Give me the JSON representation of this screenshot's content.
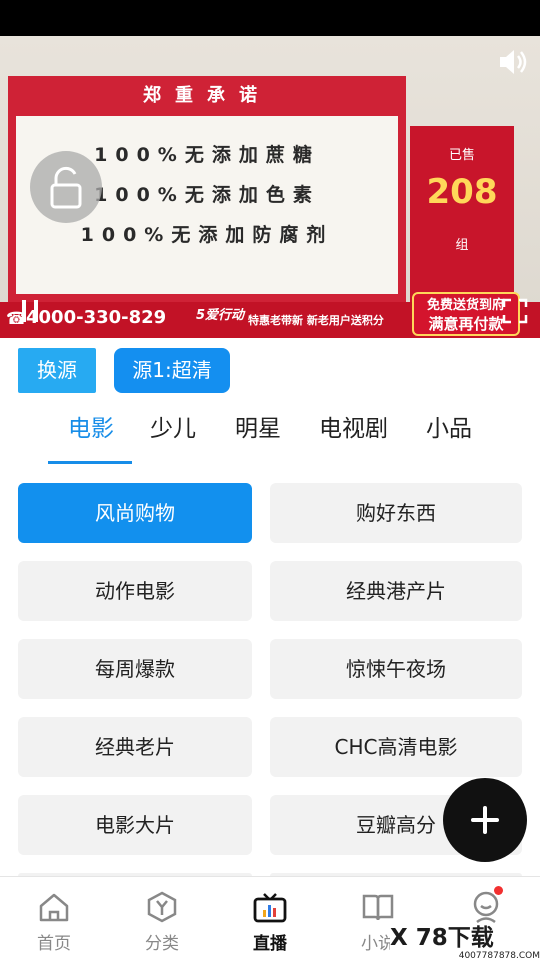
{
  "video": {
    "board_title": "郑重承诺",
    "promises": [
      "100%无添加蔗糖",
      "100%无添加色素",
      "100%无添加防腐剂"
    ],
    "sold_label": "已售",
    "sold_count": "208",
    "sold_unit": "组",
    "ticker_phone": "4000-330-829",
    "ticker_promo": "特惠老带新  新老用户送积分",
    "ticker_tag": "5爱行动",
    "badge_line1": "免费送货到府",
    "badge_line2": "满意再付款"
  },
  "source": {
    "switch_label": "换源",
    "current_label": "源1:超清"
  },
  "tabs": [
    {
      "label": "电影",
      "active": true
    },
    {
      "label": "少儿",
      "active": false
    },
    {
      "label": "明星",
      "active": false
    },
    {
      "label": "电视剧",
      "active": false
    },
    {
      "label": "小品",
      "active": false
    }
  ],
  "channels": [
    {
      "label": "风尚购物",
      "selected": true
    },
    {
      "label": "购好东西",
      "selected": false
    },
    {
      "label": "动作电影",
      "selected": false
    },
    {
      "label": "经典港产片",
      "selected": false
    },
    {
      "label": "每周爆款",
      "selected": false
    },
    {
      "label": "惊悚午夜场",
      "selected": false
    },
    {
      "label": "经典老片",
      "selected": false
    },
    {
      "label": "CHC高清电影",
      "selected": false
    },
    {
      "label": "电影大片",
      "selected": false
    },
    {
      "label": "豆瓣高分",
      "selected": false
    }
  ],
  "bottom_nav": [
    {
      "label": "首页",
      "icon": "home-icon",
      "active": false
    },
    {
      "label": "分类",
      "icon": "category-icon",
      "active": false
    },
    {
      "label": "直播",
      "icon": "live-tv-icon",
      "active": true
    },
    {
      "label": "小说",
      "icon": "book-icon",
      "active": false
    },
    {
      "label": "我的",
      "icon": "profile-icon",
      "active": false
    }
  ],
  "watermark": {
    "logo": "X 78下载",
    "url": "4007787878.COM"
  },
  "colors": {
    "accent": "#178de8",
    "selected_bg": "#1290ee",
    "brand_red": "#c21226"
  }
}
